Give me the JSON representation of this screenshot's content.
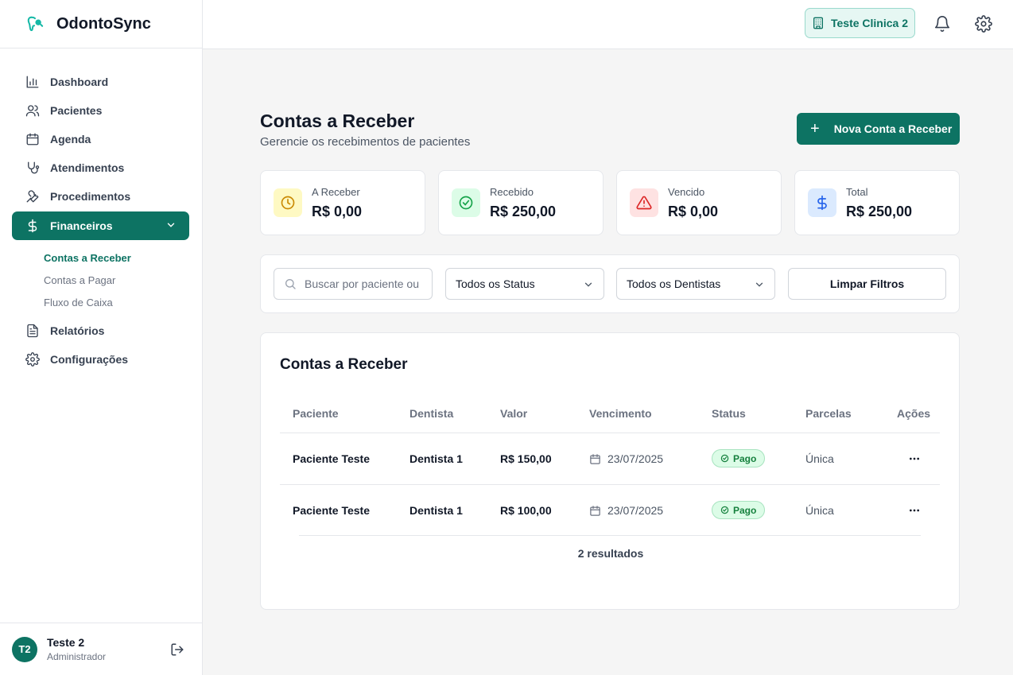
{
  "app": {
    "name": "OdontoSync"
  },
  "sidebar": {
    "items": [
      {
        "label": "Dashboard",
        "icon": "bar-chart-icon"
      },
      {
        "label": "Pacientes",
        "icon": "users-icon"
      },
      {
        "label": "Agenda",
        "icon": "calendar-icon"
      },
      {
        "label": "Atendimentos",
        "icon": "stethoscope-icon"
      },
      {
        "label": "Procedimentos",
        "icon": "wrench-icon"
      }
    ],
    "financeiros": {
      "label": "Financeiros",
      "icon": "dollar-icon",
      "subitems": [
        {
          "label": "Contas a Receber"
        },
        {
          "label": "Contas a Pagar"
        },
        {
          "label": "Fluxo de Caixa"
        }
      ]
    },
    "bottom_items": [
      {
        "label": "Relatórios",
        "icon": "file-text-icon"
      },
      {
        "label": "Configurações",
        "icon": "gear-icon"
      }
    ]
  },
  "user": {
    "initials": "T2",
    "name": "Teste 2",
    "role": "Administrador"
  },
  "topbar": {
    "clinic": "Teste Clinica 2"
  },
  "page": {
    "title": "Contas a Receber",
    "subtitle": "Gerencie os recebimentos de pacientes",
    "new_button": "Nova Conta a Receber"
  },
  "stats": [
    {
      "label": "A Receber",
      "value": "R$ 0,00",
      "icon": "clock-icon",
      "color": "#ca8a04",
      "bg": "#fef9c3"
    },
    {
      "label": "Recebido",
      "value": "R$ 250,00",
      "icon": "check-circle-icon",
      "color": "#16a34a",
      "bg": "#dcfce7"
    },
    {
      "label": "Vencido",
      "value": "R$ 0,00",
      "icon": "alert-triangle-icon",
      "color": "#dc2626",
      "bg": "#fee2e2"
    },
    {
      "label": "Total",
      "value": "R$ 250,00",
      "icon": "dollar-icon",
      "color": "#2563eb",
      "bg": "#dbeafe"
    }
  ],
  "filters": {
    "search_placeholder": "Buscar por paciente ou",
    "status": "Todos os Status",
    "dentist": "Todos os Dentistas",
    "clear": "Limpar Filtros"
  },
  "table": {
    "title": "Contas a Receber",
    "columns": [
      "Paciente",
      "Dentista",
      "Valor",
      "Vencimento",
      "Status",
      "Parcelas",
      "Ações"
    ],
    "rows": [
      {
        "paciente": "Paciente Teste",
        "dentista": "Dentista 1",
        "valor": "R$ 150,00",
        "vencimento": "23/07/2025",
        "status": "Pago",
        "parcelas": "Única"
      },
      {
        "paciente": "Paciente Teste",
        "dentista": "Dentista 1",
        "valor": "R$ 100,00",
        "vencimento": "23/07/2025",
        "status": "Pago",
        "parcelas": "Única"
      }
    ],
    "results": "2 resultados"
  },
  "colors": {
    "primary": "#0d7363",
    "accent_light": "#e6f7f3"
  }
}
